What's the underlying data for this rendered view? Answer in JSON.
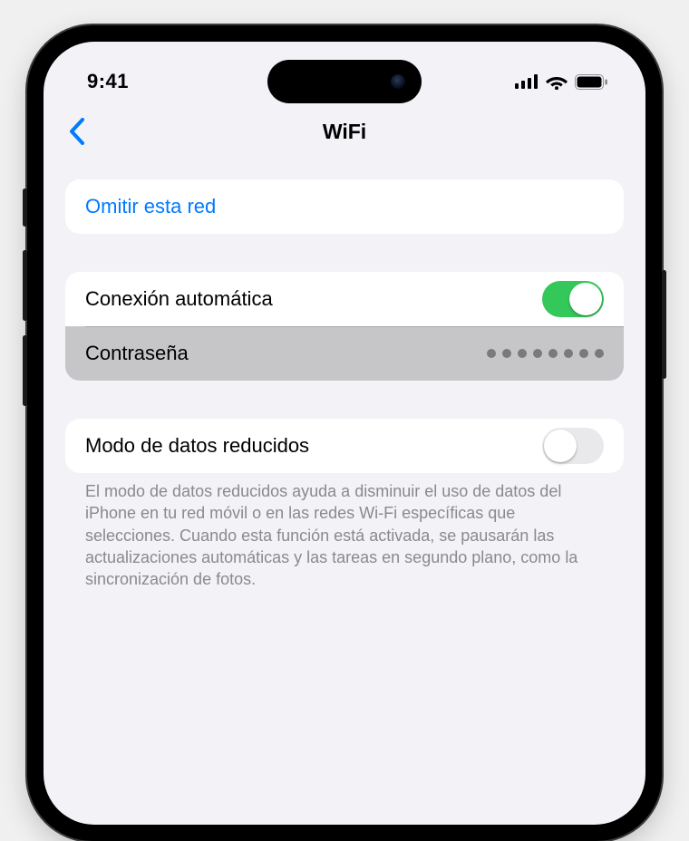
{
  "status": {
    "time": "9:41"
  },
  "nav": {
    "title": "WiFi"
  },
  "actions": {
    "forget_label": "Omitir esta red"
  },
  "auto_join": {
    "label": "Conexión automática",
    "enabled": true
  },
  "password": {
    "label": "Contraseña",
    "dot_count": 8
  },
  "low_data": {
    "label": "Modo de datos reducidos",
    "enabled": false,
    "footer": "El modo de datos reducidos ayuda a disminuir el uso de datos del iPhone en tu red móvil o en las redes Wi-Fi específicas que selecciones. Cuando esta función está activada, se pausarán las actualizaciones automáticas y las tareas en segundo plano, como la sincronización de fotos."
  },
  "colors": {
    "tint": "#007aff",
    "toggle_on": "#34c759",
    "background": "#f2f2f7"
  }
}
